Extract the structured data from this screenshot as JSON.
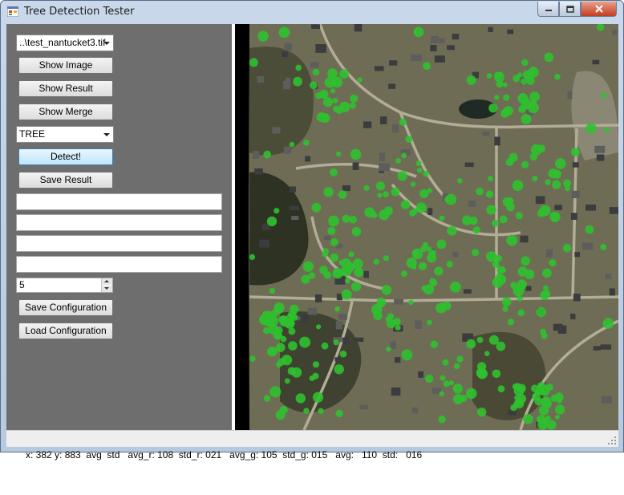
{
  "window": {
    "title": "Tree Detection Tester"
  },
  "controls": {
    "file_combo": "..\\test_nantucket3.tif",
    "show_image": "Show Image",
    "show_result": "Show Result",
    "show_merge": "Show Merge",
    "class_combo": "TREE",
    "detect": "Detect!",
    "save_result": "Save Result",
    "text_fields": [
      "",
      "",
      "",
      ""
    ],
    "spinner_value": "5",
    "save_config": "Save Configuration",
    "load_config": "Load Configuration"
  },
  "status": {
    "text": "x: 382 y: 883  avg  std   avg_r: 108  std_r: 021   avg_g: 105  std_g: 015   avg:   110  std:   016"
  },
  "colors": {
    "panel_bg": "#6e6e6e",
    "tree_marker": "#2fc12f"
  },
  "icons": {
    "app": "app-window-icon",
    "minimize": "minimize-icon",
    "maximize": "maximize-icon",
    "close": "close-icon"
  }
}
